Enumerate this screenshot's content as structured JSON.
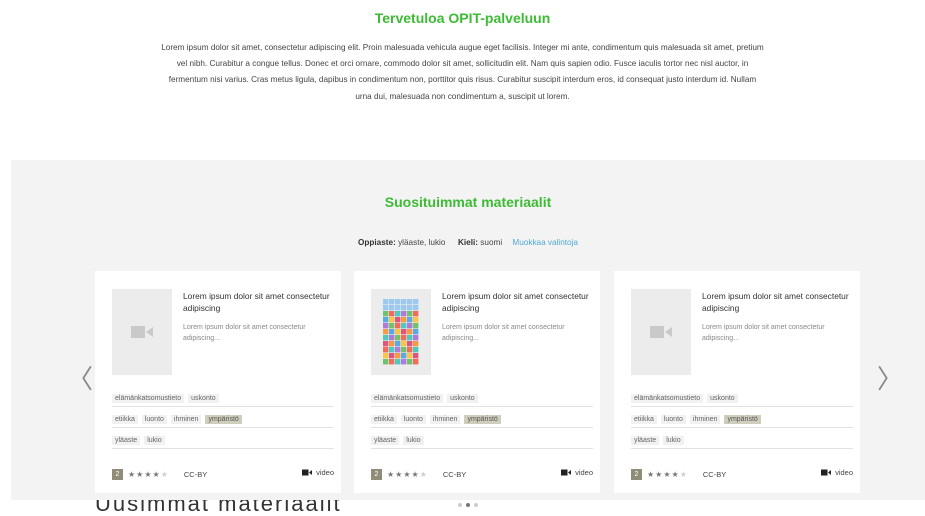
{
  "welcome": {
    "title": "Tervetuloa OPIT-palveluun",
    "text": "Lorem ipsum dolor sit amet, consectetur adipiscing elit. Proin malesuada vehicula augue eget facilisis. Integer mi ante, condimentum quis malesuada sit amet, pretium vel nibh. Curabitur a congue tellus. Donec et orci ornare, commodo dolor sit amet, sollicitudin elit. Nam quis sapien odio. Fusce iaculis tortor nec nisl auctor, in fermentum nisi varius. Cras metus ligula, dapibus in condimentum non, porttitor quis risus. Curabitur suscipit interdum eros, id consequat justo interdum id. Nullam urna dui, malesuada non condimentum a, suscipit ut lorem."
  },
  "popular": {
    "title": "Suosituimmat materiaalit",
    "filters": {
      "subject_label": "Oppiaste:",
      "subject_value": "yläaste, lukio",
      "language_label": "Kieli:",
      "language_value": "suomi",
      "edit_link": "Muokkaa valintoja"
    },
    "prev_arrow": "〈",
    "next_arrow": "〉",
    "cards": [
      {
        "title": "Lorem ipsum dolor sit amet consectetur adipiscing",
        "description": "Lorem ipsum dolor sit amet consectetur adipiscing...",
        "thumbnail": "video-camera-icon",
        "tags_row1": [
          "elämänkatsomustieto",
          "uskonto"
        ],
        "tags_row2": [
          "etiikka",
          "luonto",
          "ihminen",
          "ympäristö"
        ],
        "tags_row3": [
          "yläaste",
          "lukio"
        ],
        "level": "2",
        "stars": "★★★★★",
        "rating": 4,
        "license": "CC-BY",
        "media": "video"
      },
      {
        "title": "Lorem ipsum dolor sit amet consectetur adipiscing",
        "description": "Lorem ipsum dolor sit amet consectetur adipiscing...",
        "thumbnail": "colorful-grid-image",
        "tags_row1": [
          "elämänkatsomustieto",
          "uskonto"
        ],
        "tags_row2": [
          "etiikka",
          "luonto",
          "ihminen",
          "ympäristö"
        ],
        "tags_row3": [
          "yläaste",
          "lukio"
        ],
        "level": "2",
        "stars": "★★★★★",
        "rating": 4,
        "license": "CC-BY",
        "media": "video"
      },
      {
        "title": "Lorem ipsum dolor sit amet consectetur adipiscing",
        "description": "Lorem ipsum dolor sit amet consectetur adipiscing...",
        "thumbnail": "video-camera-icon",
        "tags_row1": [
          "elämänkatsomustieto",
          "uskonto"
        ],
        "tags_row2": [
          "etiikka",
          "luonto",
          "ihminen",
          "ympäristö"
        ],
        "tags_row3": [
          "yläaste",
          "lukio"
        ],
        "level": "2",
        "stars": "★★★★★",
        "rating": 4,
        "license": "CC-BY",
        "media": "video"
      }
    ],
    "highlighted_tag": "ympäristö",
    "active_page": 2,
    "page_count": 3
  },
  "bottom_cutoff_text": "Uusimmat materiaalit",
  "colors": {
    "accent_green": "#3dbb34",
    "link_blue": "#4fa8d8",
    "section_bg": "#f3f3f3",
    "tag_highlight": "#cfcebc",
    "level_badge": "#8f8c78"
  }
}
